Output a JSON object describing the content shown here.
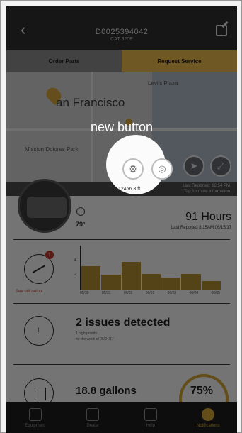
{
  "header": {
    "title": "D0025394042",
    "subtitle": "CAT 320E"
  },
  "tabs": [
    {
      "label": "Order Parts"
    },
    {
      "label": "Request Service"
    }
  ],
  "map": {
    "city": "an Francisco",
    "places": [
      "Mission Dolores Park",
      "Levi's Plaza"
    ],
    "status_line1": "Last Reported: 12:54 PM",
    "status_line2": "Tap for more information"
  },
  "spotlight": {
    "tip": "new button",
    "caption": "12456.3 ft"
  },
  "equipment": {
    "temperature": "79°",
    "hours": "91 Hours",
    "last_reported": "Last Reported 8:15AM 06/15/17"
  },
  "utilization": {
    "label": "See utilization",
    "badge": "1"
  },
  "issues": {
    "title": "2 issues detected",
    "sub1": "1 high priority",
    "sub2": "for the week of 06/04/17"
  },
  "fuel": {
    "amount": "18.8 gallons",
    "percent": "75%",
    "level": 0.75
  },
  "nav": [
    {
      "label": "Equipment",
      "icon": "equipment-icon",
      "active": false
    },
    {
      "label": "Dealer",
      "icon": "dealer-icon",
      "active": false
    },
    {
      "label": "Help",
      "icon": "help-icon",
      "active": false
    },
    {
      "label": "Notifications",
      "icon": "bell-icon",
      "active": true
    }
  ],
  "chart_data": {
    "type": "bar",
    "categories": [
      "05/30",
      "05/31",
      "06/01",
      "06/02",
      "06/03",
      "06/04",
      "06/05"
    ],
    "values": [
      3.2,
      2.0,
      3.8,
      2.1,
      1.6,
      2.1,
      1.2
    ],
    "ylim": [
      0,
      6
    ],
    "yticks": [
      "4",
      "2"
    ],
    "colors": {
      "bar": "#ae8d2f"
    }
  }
}
